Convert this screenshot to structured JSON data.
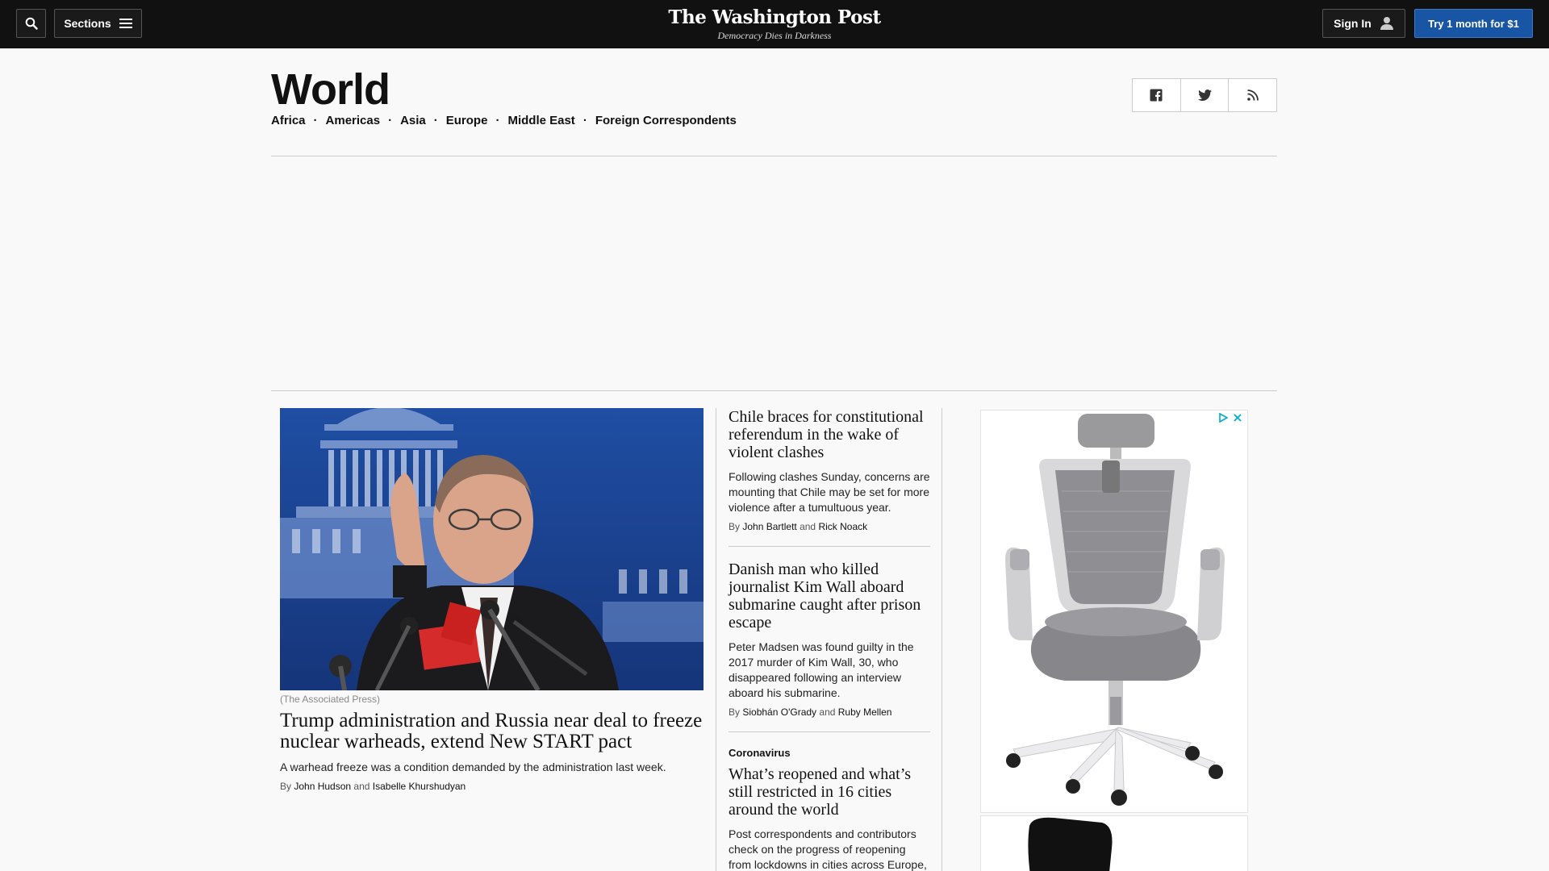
{
  "header": {
    "sections_label": "Sections",
    "logo": "The Washington Post",
    "tagline": "Democracy Dies in Darkness",
    "signin_label": "Sign In",
    "cta_label": "Try 1 month for $1"
  },
  "section": {
    "title": "World",
    "nav": [
      "Africa",
      "Americas",
      "Asia",
      "Europe",
      "Middle East",
      "Foreign Correspondents"
    ]
  },
  "lead": {
    "credit": "(The Associated Press)",
    "headline": "Trump administration and Russia near deal to freeze nuclear warheads, extend New START pact",
    "blurb": "A warhead freeze was a condition demanded by the administration last week.",
    "by": "By",
    "and": "and",
    "authors": [
      "John Hudson",
      "Isabelle Khurshudyan"
    ]
  },
  "stories": [
    {
      "headline": "Chile braces for constitutional referendum in the wake of violent clashes",
      "blurb": "Following clashes Sunday, concerns are mounting that Chile may be set for more violence after a tumultuous year.",
      "by": "By",
      "and": "and",
      "authors": [
        "John Bartlett",
        "Rick Noack"
      ]
    },
    {
      "headline": "Danish man who killed journalist Kim Wall aboard submarine caught after prison escape",
      "blurb": "Peter Madsen was found guilty in the 2017 murder of Kim Wall, 30, who disappeared following an interview aboard his submarine.",
      "by": "By",
      "and": "and",
      "authors": [
        "Siobhán O'Grady",
        "Ruby Mellen"
      ]
    },
    {
      "kicker": "Coronavirus",
      "headline": "What’s reopened and what’s still restricted in 16 cities around the world",
      "blurb": "Post correspondents and contributors check on the progress of reopening from lockdowns in cities across Europe,"
    }
  ],
  "colors": {
    "topbar": "#111111",
    "cta": "#1955a5",
    "page_bg": "#f9f9f9"
  },
  "icons": [
    "search-icon",
    "hamburger-icon",
    "user-icon",
    "facebook-icon",
    "twitter-icon",
    "rss-icon",
    "adchoices-icon",
    "close-icon"
  ]
}
